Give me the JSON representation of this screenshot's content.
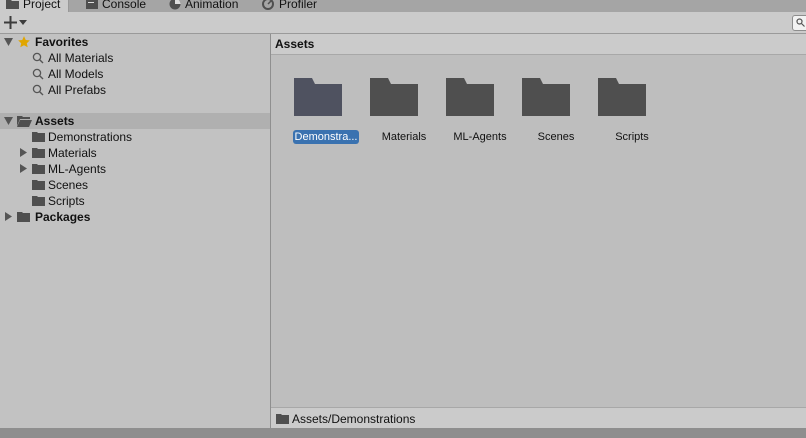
{
  "tabs": [
    {
      "label": "Project",
      "icon": "folder-icon",
      "active": true
    },
    {
      "label": "Console",
      "icon": "console-icon",
      "active": false
    },
    {
      "label": "Animation",
      "icon": "animation-icon",
      "active": false
    },
    {
      "label": "Profiler",
      "icon": "profiler-icon",
      "active": false
    }
  ],
  "toolbar": {
    "add_label": "+",
    "add_icon": "plus-icon",
    "search_icon": "search-icon"
  },
  "favorites": {
    "label": "Favorites",
    "items": [
      "All Materials",
      "All Models",
      "All Prefabs"
    ]
  },
  "assets_tree": {
    "label": "Assets",
    "children": [
      "Demonstrations",
      "Materials",
      "ML-Agents",
      "Scenes",
      "Scripts"
    ],
    "packages_label": "Packages"
  },
  "right_panel": {
    "header": "Assets",
    "folders": [
      "Demonstra...",
      "Materials",
      "ML-Agents",
      "Scenes",
      "Scripts"
    ],
    "selected_index": 0
  },
  "footer": {
    "path": "Assets/Demonstrations"
  },
  "colors": {
    "selection": "#3a72b0",
    "star": "#e0a600",
    "folder": "#4f4f4f"
  }
}
